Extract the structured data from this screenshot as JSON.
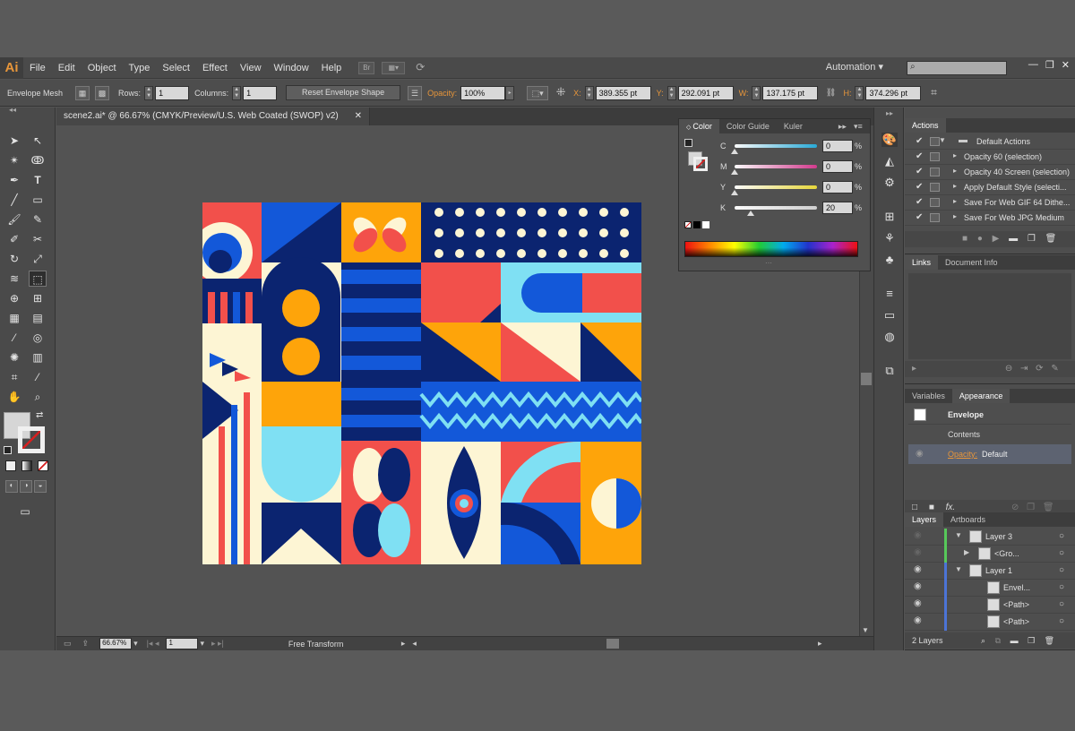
{
  "menubar": {
    "logo": "Ai",
    "items": [
      "File",
      "Edit",
      "Object",
      "Type",
      "Select",
      "Effect",
      "View",
      "Window",
      "Help"
    ],
    "workspace": "Automation"
  },
  "control": {
    "mode": "Envelope Mesh",
    "rows_label": "Rows:",
    "rows_value": "1",
    "columns_label": "Columns:",
    "columns_value": "1",
    "reset_button": "Reset Envelope Shape",
    "opacity_label": "Opacity:",
    "opacity_value": "100%",
    "x_label": "X:",
    "x_value": "389.355 pt",
    "y_label": "Y:",
    "y_value": "292.091 pt",
    "w_label": "W:",
    "w_value": "137.175 pt",
    "h_label": "H:",
    "h_value": "374.296 pt"
  },
  "document": {
    "tab_title": "scene2.ai* @ 66.67% (CMYK/Preview/U.S. Web Coated (SWOP) v2)"
  },
  "status": {
    "zoom": "66.67%",
    "artboard": "1",
    "tool": "Free Transform"
  },
  "color_panel": {
    "tabs": [
      "Color",
      "Color Guide",
      "Kuler"
    ],
    "channels": [
      {
        "label": "C",
        "value": "0",
        "pct": "%",
        "level": 0.0,
        "color": "#28a9d6"
      },
      {
        "label": "M",
        "value": "0",
        "pct": "%",
        "level": 0.0,
        "color": "#d23a8d"
      },
      {
        "label": "Y",
        "value": "0",
        "pct": "%",
        "level": 0.0,
        "color": "#e6d63a"
      },
      {
        "label": "K",
        "value": "20",
        "pct": "%",
        "level": 0.2,
        "color": "#cfcfcf"
      }
    ]
  },
  "actions_panel": {
    "tab": "Actions",
    "rows": [
      {
        "label": "Default Actions",
        "folder": true
      },
      {
        "label": "Opacity 60 (selection)"
      },
      {
        "label": "Opacity 40 Screen (selection)"
      },
      {
        "label": "Apply Default Style (selecti..."
      },
      {
        "label": "Save For Web GIF 64 Dithe..."
      },
      {
        "label": "Save For Web JPG Medium"
      }
    ]
  },
  "links_panel": {
    "tabs": [
      "Links",
      "Document Info"
    ]
  },
  "appearance_panel": {
    "tabs": [
      "Variables",
      "Appearance"
    ],
    "title": "Envelope",
    "contents": "Contents",
    "opacity_label": "Opacity:",
    "opacity_value": "Default",
    "fx": "fx."
  },
  "layers_panel": {
    "tabs": [
      "Layers",
      "Artboards"
    ],
    "rows": [
      {
        "label": "Layer 3",
        "indent": 0,
        "color": "#57c85a"
      },
      {
        "label": "<Gro...",
        "indent": 1,
        "color": "#57c85a"
      },
      {
        "label": "Layer 1",
        "indent": 0,
        "color": "#4c74d6"
      },
      {
        "label": "Envel...",
        "indent": 2,
        "color": "#4c74d6"
      },
      {
        "label": "<Path>",
        "indent": 2,
        "color": "#4c74d6"
      },
      {
        "label": "<Path>",
        "indent": 2,
        "color": "#4c74d6"
      }
    ],
    "count": "2 Layers"
  },
  "colors": {
    "navy": "#0b2470",
    "blue": "#1358d9",
    "red": "#f2504b",
    "orange": "#fea40a",
    "cream": "#fdf5d4",
    "sky": "#7fe0f3",
    "accent": "#e8963a"
  }
}
